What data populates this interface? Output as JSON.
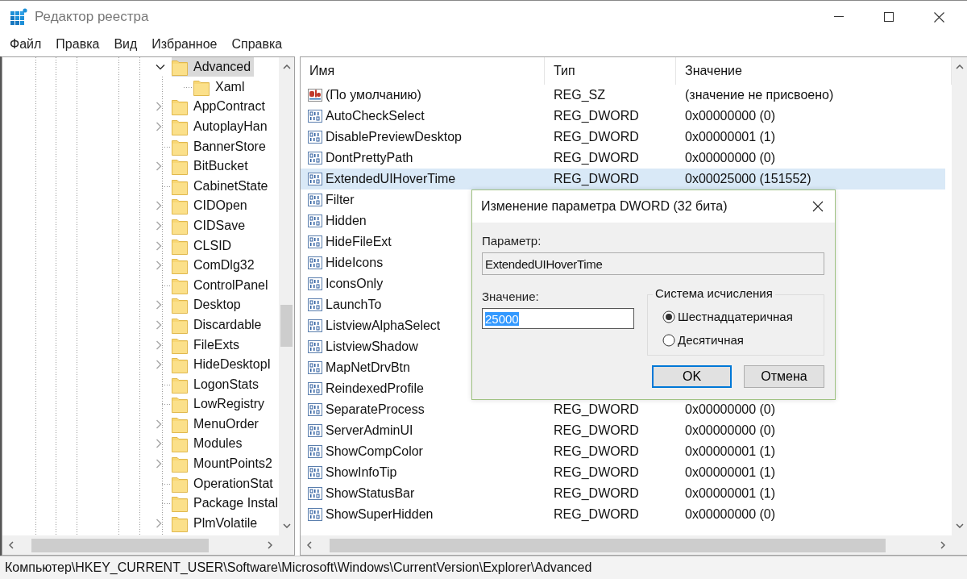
{
  "window": {
    "title": "Редактор реестра"
  },
  "menu": [
    "Файл",
    "Правка",
    "Вид",
    "Избранное",
    "Справка"
  ],
  "tree": {
    "items": [
      {
        "name": "Advanced",
        "expandable": true,
        "expanded": true,
        "selected": true,
        "children": [
          {
            "name": "Xaml",
            "expandable": false,
            "expanded": false,
            "selected": false
          }
        ]
      },
      {
        "name": "AppContract",
        "expandable": true,
        "expanded": false,
        "selected": false
      },
      {
        "name": "AutoplayHan",
        "expandable": true,
        "expanded": false,
        "selected": false
      },
      {
        "name": "BannerStore",
        "expandable": false,
        "expanded": false,
        "selected": false
      },
      {
        "name": "BitBucket",
        "expandable": true,
        "expanded": false,
        "selected": false
      },
      {
        "name": "CabinetState",
        "expandable": false,
        "expanded": false,
        "selected": false
      },
      {
        "name": "CIDOpen",
        "expandable": true,
        "expanded": false,
        "selected": false
      },
      {
        "name": "CIDSave",
        "expandable": true,
        "expanded": false,
        "selected": false
      },
      {
        "name": "CLSID",
        "expandable": true,
        "expanded": false,
        "selected": false
      },
      {
        "name": "ComDlg32",
        "expandable": true,
        "expanded": false,
        "selected": false
      },
      {
        "name": "ControlPanel",
        "expandable": false,
        "expanded": false,
        "selected": false
      },
      {
        "name": "Desktop",
        "expandable": true,
        "expanded": false,
        "selected": false
      },
      {
        "name": "Discardable",
        "expandable": true,
        "expanded": false,
        "selected": false
      },
      {
        "name": "FileExts",
        "expandable": true,
        "expanded": false,
        "selected": false
      },
      {
        "name": "HideDesktopI",
        "expandable": true,
        "expanded": false,
        "selected": false
      },
      {
        "name": "LogonStats",
        "expandable": false,
        "expanded": false,
        "selected": false
      },
      {
        "name": "LowRegistry",
        "expandable": false,
        "expanded": false,
        "selected": false
      },
      {
        "name": "MenuOrder",
        "expandable": true,
        "expanded": false,
        "selected": false
      },
      {
        "name": "Modules",
        "expandable": true,
        "expanded": false,
        "selected": false
      },
      {
        "name": "MountPoints2",
        "expandable": true,
        "expanded": false,
        "selected": false
      },
      {
        "name": "OperationStat",
        "expandable": false,
        "expanded": false,
        "selected": false
      },
      {
        "name": "Package Instal",
        "expandable": false,
        "expanded": false,
        "selected": false
      },
      {
        "name": "PlmVolatile",
        "expandable": true,
        "expanded": false,
        "selected": false
      }
    ]
  },
  "list": {
    "columns": [
      "Имя",
      "Тип",
      "Значение"
    ],
    "rows": [
      {
        "kind": "string",
        "name": "(По умолчанию)",
        "type": "REG_SZ",
        "value": "(значение не присвоено)",
        "selected": false
      },
      {
        "kind": "dword",
        "name": "AutoCheckSelect",
        "type": "REG_DWORD",
        "value": "0x00000000 (0)",
        "selected": false
      },
      {
        "kind": "dword",
        "name": "DisablePreviewDesktop",
        "type": "REG_DWORD",
        "value": "0x00000001 (1)",
        "selected": false
      },
      {
        "kind": "dword",
        "name": "DontPrettyPath",
        "type": "REG_DWORD",
        "value": "0x00000000 (0)",
        "selected": false
      },
      {
        "kind": "dword",
        "name": "ExtendedUIHoverTime",
        "type": "REG_DWORD",
        "value": "0x00025000 (151552)",
        "selected": true
      },
      {
        "kind": "dword",
        "name": "Filter",
        "selected": false
      },
      {
        "kind": "dword",
        "name": "Hidden",
        "selected": false
      },
      {
        "kind": "dword",
        "name": "HideFileExt",
        "selected": false
      },
      {
        "kind": "dword",
        "name": "HideIcons",
        "selected": false
      },
      {
        "kind": "dword",
        "name": "IconsOnly",
        "selected": false
      },
      {
        "kind": "dword",
        "name": "LaunchTo",
        "selected": false
      },
      {
        "kind": "dword",
        "name": "ListviewAlphaSelect",
        "selected": false
      },
      {
        "kind": "dword",
        "name": "ListviewShadow",
        "selected": false
      },
      {
        "kind": "dword",
        "name": "MapNetDrvBtn",
        "selected": false
      },
      {
        "kind": "dword",
        "name": "ReindexedProfile",
        "selected": false
      },
      {
        "kind": "dword",
        "name": "SeparateProcess",
        "type": "REG_DWORD",
        "value": "0x00000000 (0)",
        "selected": false
      },
      {
        "kind": "dword",
        "name": "ServerAdminUI",
        "type": "REG_DWORD",
        "value": "0x00000000 (0)",
        "selected": false
      },
      {
        "kind": "dword",
        "name": "ShowCompColor",
        "type": "REG_DWORD",
        "value": "0x00000001 (1)",
        "selected": false
      },
      {
        "kind": "dword",
        "name": "ShowInfoTip",
        "type": "REG_DWORD",
        "value": "0x00000001 (1)",
        "selected": false
      },
      {
        "kind": "dword",
        "name": "ShowStatusBar",
        "type": "REG_DWORD",
        "value": "0x00000001 (1)",
        "selected": false
      },
      {
        "kind": "dword",
        "name": "ShowSuperHidden",
        "type": "REG_DWORD",
        "value": "0x00000000 (0)",
        "selected": false
      }
    ]
  },
  "dialog": {
    "title": "Изменение параметра DWORD (32 бита)",
    "name_label": "Параметр:",
    "name_value": "ExtendedUIHoverTime",
    "value_label": "Значение:",
    "value": "25000",
    "value_highlighted": true,
    "base_group": {
      "title": "Система исчисления",
      "options": [
        {
          "label": "Шестнадцатеричная",
          "selected": true
        },
        {
          "label": "Десятичная",
          "selected": false
        }
      ]
    },
    "buttons": [
      {
        "label": "OK",
        "default": true
      },
      {
        "label": "Отмена",
        "default": false
      }
    ]
  },
  "status_bar": {
    "path": "Компьютер\\HKEY_CURRENT_USER\\Software\\Microsoft\\Windows\\CurrentVersion\\Explorer\\Advanced"
  }
}
